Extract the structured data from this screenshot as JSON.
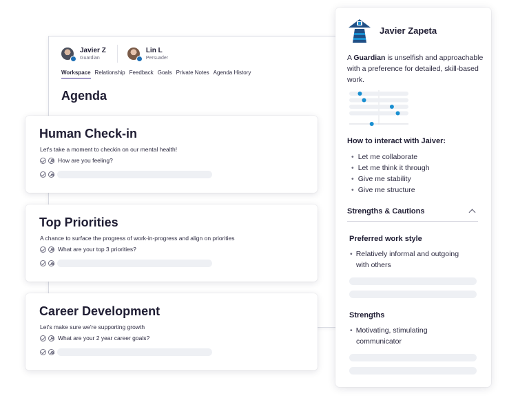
{
  "workspace": {
    "people": [
      {
        "name": "Javier Z",
        "role": "Guardian"
      },
      {
        "name": "Lin L",
        "role": "Persuader"
      }
    ],
    "tabs": [
      "Workspace",
      "Relationship",
      "Feedback",
      "Goals",
      "Private Notes",
      "Agenda History"
    ],
    "active_tab": "Workspace",
    "title": "Agenda"
  },
  "cards": [
    {
      "title": "Human Check-in",
      "subtitle": "Let's take a moment to checkin on our mental health!",
      "question": "How are you feeling?"
    },
    {
      "title": "Top Priorities",
      "subtitle": "A chance to surface the progress of work-in-progress and align on priorities",
      "question": "What are your top 3 priorities?"
    },
    {
      "title": "Career Development",
      "subtitle": "Let's make sure we're supporting growth",
      "question": "What are your 2 year career goals?"
    }
  ],
  "profile": {
    "name": "Javier Zapeta",
    "desc_prefix": "A ",
    "desc_type": "Guardian",
    "desc_rest": " is unselfish and approachable with a preference for detailed, skill-based work.",
    "trait_scale": [
      0.18,
      0.25,
      0.72,
      0.82,
      0.38
    ],
    "interact_heading": "How to interact with Jaiver:",
    "interact_items": [
      "Let me collaborate",
      "Let me think it through",
      "Give me stability",
      "Give me structure"
    ],
    "strengths_heading": "Strengths & Cautions",
    "sections": [
      {
        "heading": "Preferred work style",
        "text": "Relatively informal and outgoing with others"
      },
      {
        "heading": "Strengths",
        "text": "Motivating, stimulating communicator"
      }
    ]
  },
  "colors": {
    "accent": "#3b2a8a",
    "dot": "#1a8fd1",
    "brand_dark": "#1f4f86",
    "text": "#1f1d33"
  }
}
